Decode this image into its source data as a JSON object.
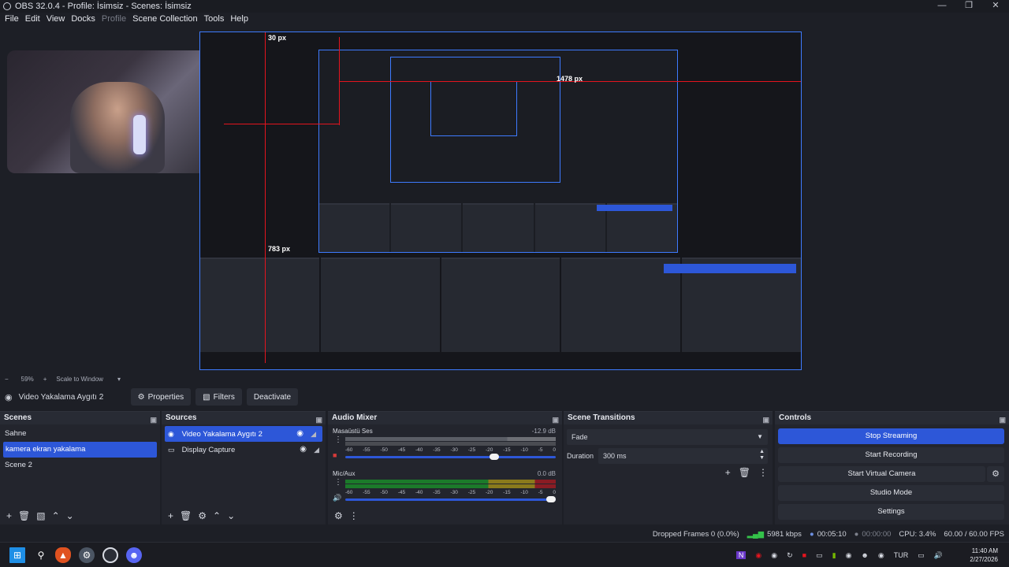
{
  "window": {
    "title": "OBS 32.0.4 - Profile: İsimsiz - Scenes: İsimsiz"
  },
  "menu": {
    "items": [
      "File",
      "Edit",
      "View",
      "Docks",
      "Profile",
      "Scene Collection",
      "Tools",
      "Help"
    ]
  },
  "preview": {
    "labels": {
      "top": "30 px",
      "right": "1478 px",
      "nested_small": "783 px",
      "left": "783 px"
    },
    "zoom": "59%",
    "scale_mode": "Scale to Window"
  },
  "source_toolbar": {
    "source_name": "Video Yakalama Aygıtı 2",
    "properties": "Properties",
    "filters": "Filters",
    "deactivate": "Deactivate"
  },
  "scenes": {
    "title": "Scenes",
    "items": [
      "Sahne",
      "kamera ekran yakalama",
      "Scene 2"
    ],
    "selected_index": 1
  },
  "sources": {
    "title": "Sources",
    "items": [
      "Video Yakalama Aygıtı 2",
      "Display Capture"
    ],
    "selected_index": 0
  },
  "audio_mixer": {
    "title": "Audio Mixer",
    "channels": [
      {
        "name": "Masaüstü Ses",
        "db": "-12.9 dB",
        "level": 0.73
      },
      {
        "name": "Mic/Aux",
        "db": "0.0 dB",
        "level": 1.0
      }
    ],
    "scale": [
      "-60",
      "-55",
      "-50",
      "-45",
      "-40",
      "-35",
      "-30",
      "-25",
      "-20",
      "-15",
      "-10",
      "-5",
      "0"
    ]
  },
  "scene_transitions": {
    "title": "Scene Transitions",
    "transition": "Fade",
    "duration_label": "Duration",
    "duration_value": "300 ms"
  },
  "controls": {
    "title": "Controls",
    "stop_streaming": "Stop Streaming",
    "start_recording": "Start Recording",
    "start_virtual_camera": "Start Virtual Camera",
    "studio_mode": "Studio Mode",
    "settings": "Settings"
  },
  "status": {
    "dropped_frames": "Dropped Frames 0 (0.0%)",
    "bitrate": "5981 kbps",
    "stream_time": "00:05:10",
    "record_time": "00:00:00",
    "cpu": "CPU: 3.4%",
    "fps": "60.00 / 60.00 FPS"
  },
  "taskbar": {
    "language": "TUR",
    "time": "11:40 AM",
    "date": "2/27/2026"
  },
  "colors": {
    "accent": "#2d57d8",
    "preview_border": "#3e7bff",
    "guide_red": "#e4141e"
  }
}
